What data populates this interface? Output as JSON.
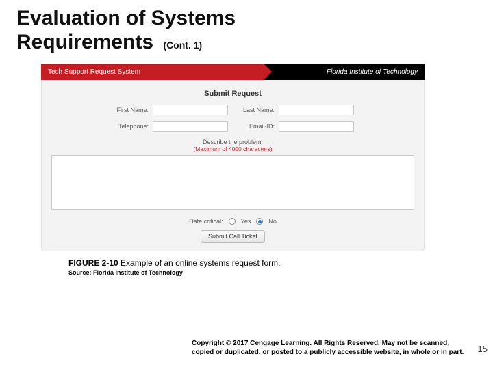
{
  "title": {
    "line1": "Evaluation of Systems",
    "line2": "Requirements",
    "cont": "(Cont. 1)"
  },
  "app": {
    "leftTitle": "Tech Support Request System",
    "rightTitle": "Florida Institute of Technology"
  },
  "form": {
    "heading": "Submit Request",
    "firstNameLabel": "First Name:",
    "lastNameLabel": "Last Name:",
    "telephoneLabel": "Telephone:",
    "emailLabel": "Email-ID:",
    "describeLabel": "Describe the problem:",
    "maxNote": "(Maximum of 4000 characters)",
    "dateCriticalLabel": "Date critical:",
    "yesLabel": "Yes",
    "noLabel": "No",
    "submitLabel": "Submit Call Ticket"
  },
  "caption": {
    "figNum": "FIGURE 2-10",
    "text": " Example of an online systems request form."
  },
  "source": "Source: Florida Institute of Technology",
  "copyright": "Copyright © 2017 Cengage Learning. All Rights Reserved. May not be scanned, copied or duplicated, or posted to a publicly accessible website, in whole or in part.",
  "pageNumber": "15"
}
